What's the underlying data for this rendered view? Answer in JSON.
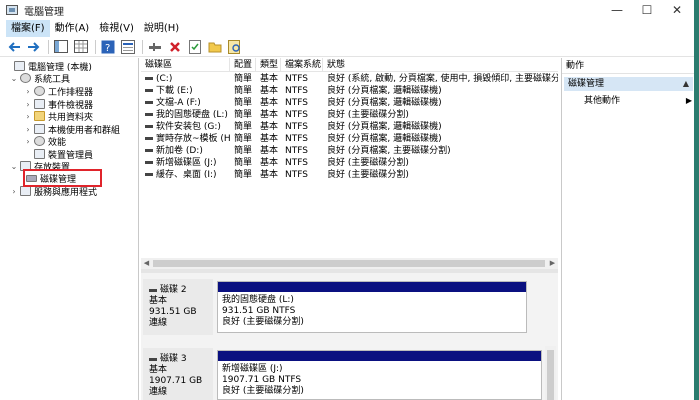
{
  "window": {
    "title": "電腦管理",
    "controls": {
      "minimize": "—",
      "maximize": "☐",
      "close": "✕"
    }
  },
  "menu": [
    "檔案(F)",
    "動作(A)",
    "檢視(V)",
    "說明(H)"
  ],
  "toolbar": {
    "icons": [
      "back-arrow-icon",
      "forward-arrow-icon",
      "show-hide-tree-icon",
      "grid-view-icon",
      "help-icon",
      "properties-icon",
      "connect-icon",
      "delete-icon",
      "check-icon",
      "open-folder-icon",
      "search-icon"
    ]
  },
  "tree": {
    "root": "電腦管理 (本機)",
    "system_tools": "系統工具",
    "task_scheduler": "工作排程器",
    "event_viewer": "事件檢視器",
    "shared_folders": "共用資料夾",
    "local_users": "本機使用者和群組",
    "performance": "效能",
    "device_manager": "裝置管理員",
    "storage": "存放裝置",
    "disk_management": "磁碟管理",
    "services": "服務與應用程式"
  },
  "volume_list": {
    "headers": [
      "磁碟區",
      "配置",
      "類型",
      "檔案系統",
      "狀態"
    ],
    "rows": [
      [
        "(C:)",
        "簡單",
        "基本",
        "NTFS",
        "良好 (系統, 啟動, 分頁檔案, 使用中, 損毀傾印, 主要磁碟分割)"
      ],
      [
        "下載 (E:)",
        "簡單",
        "基本",
        "NTFS",
        "良好 (分頁檔案, 邏輯磁碟機)"
      ],
      [
        "文檔-A (F:)",
        "簡單",
        "基本",
        "NTFS",
        "良好 (分頁檔案, 邏輯磁碟機)"
      ],
      [
        "我的固態硬盘 (L:)",
        "簡單",
        "基本",
        "NTFS",
        "良好 (主要磁碟分割)"
      ],
      [
        "软件安装包 (G:)",
        "簡單",
        "基本",
        "NTFS",
        "良好 (分頁檔案, 邏輯磁碟機)"
      ],
      [
        "實時存放~模板 (H:)",
        "簡單",
        "基本",
        "NTFS",
        "良好 (分頁檔案, 邏輯磁碟機)"
      ],
      [
        "新加卷 (D:)",
        "簡單",
        "基本",
        "NTFS",
        "良好 (分頁檔案, 主要磁碟分割)"
      ],
      [
        "新增磁碟區 (J:)",
        "簡單",
        "基本",
        "NTFS",
        "良好 (主要磁碟分割)"
      ],
      [
        "緩存、桌面 (I:)",
        "簡單",
        "基本",
        "NTFS",
        "良好 (主要磁碟分割)"
      ]
    ]
  },
  "disks": [
    {
      "name": "磁碟 2",
      "type": "基本",
      "size": "931.51 GB",
      "status": "連線",
      "partition": {
        "name": "我的固態硬盘 (L:)",
        "size": "931.51 GB NTFS",
        "status": "良好 (主要磁碟分割)"
      }
    },
    {
      "name": "磁碟 3",
      "type": "基本",
      "size": "1907.71 GB",
      "status": "連線",
      "partition": {
        "name": "新增磁碟區 (J:)",
        "size": "1907.71 GB NTFS",
        "status": "良好 (主要磁碟分割)"
      }
    }
  ],
  "actions": {
    "header": "動作",
    "section": "磁碟管理",
    "more": "其他動作"
  }
}
